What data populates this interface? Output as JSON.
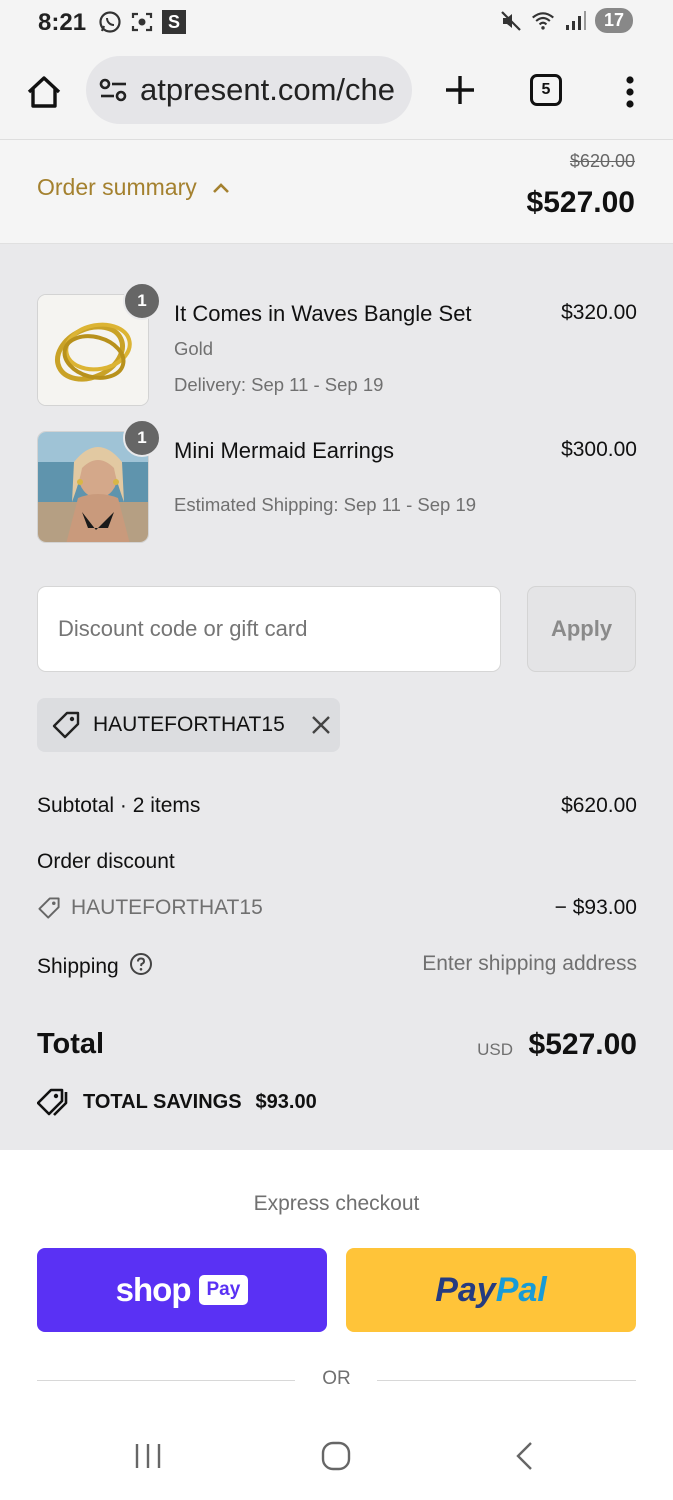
{
  "status_bar": {
    "time": "8:21",
    "s_label": "S",
    "battery": "17"
  },
  "browser": {
    "url": "atpresent.com/che",
    "tab_count": "5"
  },
  "summary_header": {
    "toggle_label": "Order summary",
    "original_price": "$620.00",
    "total": "$527.00"
  },
  "items": [
    {
      "quantity": "1",
      "name": "It Comes in Waves Bangle Set",
      "price": "$320.00",
      "variant": "Gold",
      "delivery": "Delivery: Sep 11 - Sep 19"
    },
    {
      "quantity": "1",
      "name": "Mini Mermaid Earrings",
      "price": "$300.00",
      "delivery": "Estimated Shipping: Sep 11 - Sep 19"
    }
  ],
  "discount": {
    "placeholder": "Discount code or gift card",
    "apply_label": "Apply",
    "applied_code": "HAUTEFORTHAT15"
  },
  "totals": {
    "subtotal_label": "Subtotal · 2 items",
    "subtotal_value": "$620.00",
    "discount_label": "Order discount",
    "discount_code": "HAUTEFORTHAT15",
    "discount_value": "− $93.00",
    "shipping_label": "Shipping",
    "shipping_value": "Enter shipping address",
    "total_label": "Total",
    "currency": "USD",
    "total_value": "$527.00",
    "savings_label": "TOTAL SAVINGS",
    "savings_value": "$93.00"
  },
  "express": {
    "title": "Express checkout",
    "shop_label": "shop",
    "shop_pay_label": "Pay",
    "paypal_part1": "Pay",
    "paypal_part2": "Pal",
    "or_label": "OR"
  },
  "colors": {
    "accent": "#a4812f",
    "shop_pay": "#5a31f4",
    "paypal_yellow": "#ffc439"
  }
}
